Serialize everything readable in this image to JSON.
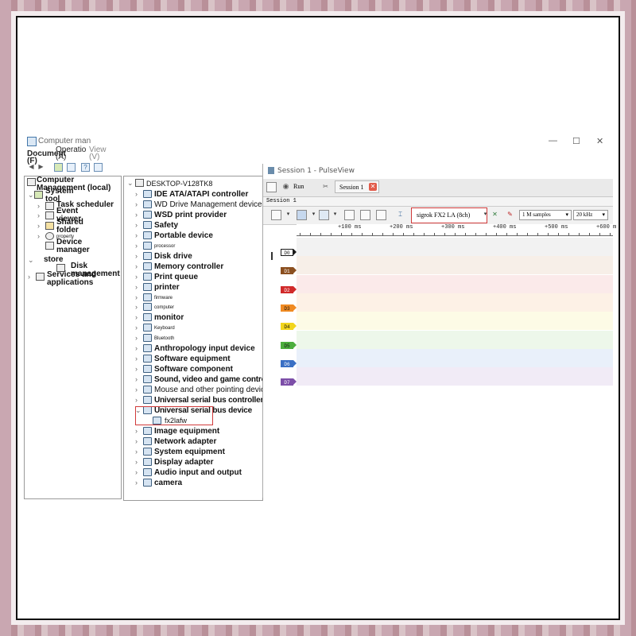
{
  "computer_management": {
    "title": "Computer man",
    "window_controls": [
      "—",
      "☐",
      "✕"
    ],
    "menu": [
      {
        "label": "Document (F)"
      },
      {
        "label": "Operatio (A)"
      },
      {
        "label": "View (V)"
      }
    ],
    "left_tree": [
      {
        "label": "Computer Management (local)",
        "level": 0
      },
      {
        "label": "System tool",
        "level": 1
      },
      {
        "label": "Task scheduler",
        "level": 2
      },
      {
        "label": "Event viewer",
        "level": 2
      },
      {
        "label": "Shared folder",
        "level": 2
      },
      {
        "label": "property",
        "level": 2
      },
      {
        "label": "Device manager",
        "level": 2
      },
      {
        "label": "store",
        "level": 1
      },
      {
        "label": "Disk management",
        "level": 2
      },
      {
        "label": "Services and applications",
        "level": 1
      }
    ],
    "device_tree": {
      "root": "DESKTOP-V128TK8",
      "items": [
        {
          "label": "IDE ATA/ATAPI controller",
          "style": "bold"
        },
        {
          "label": "WD Drive Management devices",
          "style": "norm"
        },
        {
          "label": "WSD print provider",
          "style": "bold"
        },
        {
          "label": "Safety",
          "style": "bold"
        },
        {
          "label": "Portable device",
          "style": "bold"
        },
        {
          "label": "processor",
          "style": "small"
        },
        {
          "label": "Disk drive",
          "style": "bold"
        },
        {
          "label": "Memory controller",
          "style": "bold"
        },
        {
          "label": "Print queue",
          "style": "bold"
        },
        {
          "label": "printer",
          "style": "bold"
        },
        {
          "label": "firmware",
          "style": "small"
        },
        {
          "label": "computer",
          "style": "small"
        },
        {
          "label": "monitor",
          "style": "bold"
        },
        {
          "label": "Keyboard",
          "style": "small"
        },
        {
          "label": "Bluetooth",
          "style": "small"
        },
        {
          "label": "Anthropology input device",
          "style": "bold"
        },
        {
          "label": "Software equipment",
          "style": "bold"
        },
        {
          "label": "Software component",
          "style": "bold"
        },
        {
          "label": "Sound, video and game controllers",
          "style": "bold"
        },
        {
          "label": "Mouse and other pointing devices",
          "style": "norm"
        },
        {
          "label": "Universal serial bus controller",
          "style": "bold"
        },
        {
          "label": "Universal serial bus device",
          "style": "bold",
          "expanded": true
        },
        {
          "label": "fx2lafw",
          "style": "child"
        },
        {
          "label": "Image equipment",
          "style": "bold"
        },
        {
          "label": "Network adapter",
          "style": "bold"
        },
        {
          "label": "System equipment",
          "style": "bold"
        },
        {
          "label": "Display adapter",
          "style": "bold"
        },
        {
          "label": "Audio input and output",
          "style": "bold"
        },
        {
          "label": "camera",
          "style": "bold"
        }
      ]
    }
  },
  "pulseview": {
    "title": "Session 1 - PulseView",
    "run_label": "Run",
    "tab_label": "Session 1",
    "session_label": "Session 1",
    "device_label": "sigrok FX2 LA (8ch)",
    "samples_label": "1 M samples",
    "rate_label": "20 kHz",
    "ruler_labels": [
      "+100 ms",
      "+200 ms",
      "+300 ms",
      "+400 ms",
      "+500 ms",
      "+600 m"
    ],
    "channels": [
      {
        "name": "D0",
        "color": "#1a1a1a",
        "band": "#f2f2f2"
      },
      {
        "name": "D1",
        "color": "#8b4f1f",
        "band": "#f7efe8"
      },
      {
        "name": "D2",
        "color": "#d12a2a",
        "band": "#fbeaea"
      },
      {
        "name": "D3",
        "color": "#f08a22",
        "band": "#fdf1e6"
      },
      {
        "name": "D4",
        "color": "#f2d51c",
        "band": "#fdfbe6"
      },
      {
        "name": "D5",
        "color": "#4cae3d",
        "band": "#edf7ea"
      },
      {
        "name": "D6",
        "color": "#3a6fc4",
        "band": "#e9f0fa"
      },
      {
        "name": "D7",
        "color": "#7c4ea8",
        "band": "#f1ebf6"
      }
    ]
  }
}
